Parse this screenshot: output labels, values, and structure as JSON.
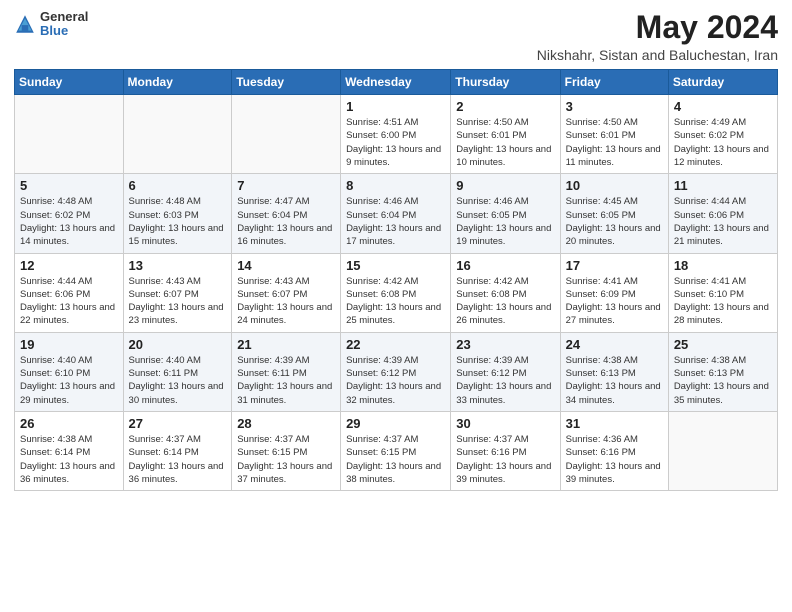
{
  "header": {
    "logo_general": "General",
    "logo_blue": "Blue",
    "month_year": "May 2024",
    "location": "Nikshahr, Sistan and Baluchestan, Iran"
  },
  "days_of_week": [
    "Sunday",
    "Monday",
    "Tuesday",
    "Wednesday",
    "Thursday",
    "Friday",
    "Saturday"
  ],
  "weeks": [
    [
      {
        "day": "",
        "info": ""
      },
      {
        "day": "",
        "info": ""
      },
      {
        "day": "",
        "info": ""
      },
      {
        "day": "1",
        "info": "Sunrise: 4:51 AM\nSunset: 6:00 PM\nDaylight: 13 hours and 9 minutes."
      },
      {
        "day": "2",
        "info": "Sunrise: 4:50 AM\nSunset: 6:01 PM\nDaylight: 13 hours and 10 minutes."
      },
      {
        "day": "3",
        "info": "Sunrise: 4:50 AM\nSunset: 6:01 PM\nDaylight: 13 hours and 11 minutes."
      },
      {
        "day": "4",
        "info": "Sunrise: 4:49 AM\nSunset: 6:02 PM\nDaylight: 13 hours and 12 minutes."
      }
    ],
    [
      {
        "day": "5",
        "info": "Sunrise: 4:48 AM\nSunset: 6:02 PM\nDaylight: 13 hours and 14 minutes."
      },
      {
        "day": "6",
        "info": "Sunrise: 4:48 AM\nSunset: 6:03 PM\nDaylight: 13 hours and 15 minutes."
      },
      {
        "day": "7",
        "info": "Sunrise: 4:47 AM\nSunset: 6:04 PM\nDaylight: 13 hours and 16 minutes."
      },
      {
        "day": "8",
        "info": "Sunrise: 4:46 AM\nSunset: 6:04 PM\nDaylight: 13 hours and 17 minutes."
      },
      {
        "day": "9",
        "info": "Sunrise: 4:46 AM\nSunset: 6:05 PM\nDaylight: 13 hours and 19 minutes."
      },
      {
        "day": "10",
        "info": "Sunrise: 4:45 AM\nSunset: 6:05 PM\nDaylight: 13 hours and 20 minutes."
      },
      {
        "day": "11",
        "info": "Sunrise: 4:44 AM\nSunset: 6:06 PM\nDaylight: 13 hours and 21 minutes."
      }
    ],
    [
      {
        "day": "12",
        "info": "Sunrise: 4:44 AM\nSunset: 6:06 PM\nDaylight: 13 hours and 22 minutes."
      },
      {
        "day": "13",
        "info": "Sunrise: 4:43 AM\nSunset: 6:07 PM\nDaylight: 13 hours and 23 minutes."
      },
      {
        "day": "14",
        "info": "Sunrise: 4:43 AM\nSunset: 6:07 PM\nDaylight: 13 hours and 24 minutes."
      },
      {
        "day": "15",
        "info": "Sunrise: 4:42 AM\nSunset: 6:08 PM\nDaylight: 13 hours and 25 minutes."
      },
      {
        "day": "16",
        "info": "Sunrise: 4:42 AM\nSunset: 6:08 PM\nDaylight: 13 hours and 26 minutes."
      },
      {
        "day": "17",
        "info": "Sunrise: 4:41 AM\nSunset: 6:09 PM\nDaylight: 13 hours and 27 minutes."
      },
      {
        "day": "18",
        "info": "Sunrise: 4:41 AM\nSunset: 6:10 PM\nDaylight: 13 hours and 28 minutes."
      }
    ],
    [
      {
        "day": "19",
        "info": "Sunrise: 4:40 AM\nSunset: 6:10 PM\nDaylight: 13 hours and 29 minutes."
      },
      {
        "day": "20",
        "info": "Sunrise: 4:40 AM\nSunset: 6:11 PM\nDaylight: 13 hours and 30 minutes."
      },
      {
        "day": "21",
        "info": "Sunrise: 4:39 AM\nSunset: 6:11 PM\nDaylight: 13 hours and 31 minutes."
      },
      {
        "day": "22",
        "info": "Sunrise: 4:39 AM\nSunset: 6:12 PM\nDaylight: 13 hours and 32 minutes."
      },
      {
        "day": "23",
        "info": "Sunrise: 4:39 AM\nSunset: 6:12 PM\nDaylight: 13 hours and 33 minutes."
      },
      {
        "day": "24",
        "info": "Sunrise: 4:38 AM\nSunset: 6:13 PM\nDaylight: 13 hours and 34 minutes."
      },
      {
        "day": "25",
        "info": "Sunrise: 4:38 AM\nSunset: 6:13 PM\nDaylight: 13 hours and 35 minutes."
      }
    ],
    [
      {
        "day": "26",
        "info": "Sunrise: 4:38 AM\nSunset: 6:14 PM\nDaylight: 13 hours and 36 minutes."
      },
      {
        "day": "27",
        "info": "Sunrise: 4:37 AM\nSunset: 6:14 PM\nDaylight: 13 hours and 36 minutes."
      },
      {
        "day": "28",
        "info": "Sunrise: 4:37 AM\nSunset: 6:15 PM\nDaylight: 13 hours and 37 minutes."
      },
      {
        "day": "29",
        "info": "Sunrise: 4:37 AM\nSunset: 6:15 PM\nDaylight: 13 hours and 38 minutes."
      },
      {
        "day": "30",
        "info": "Sunrise: 4:37 AM\nSunset: 6:16 PM\nDaylight: 13 hours and 39 minutes."
      },
      {
        "day": "31",
        "info": "Sunrise: 4:36 AM\nSunset: 6:16 PM\nDaylight: 13 hours and 39 minutes."
      },
      {
        "day": "",
        "info": ""
      }
    ]
  ],
  "accent_color": "#2a6db5"
}
